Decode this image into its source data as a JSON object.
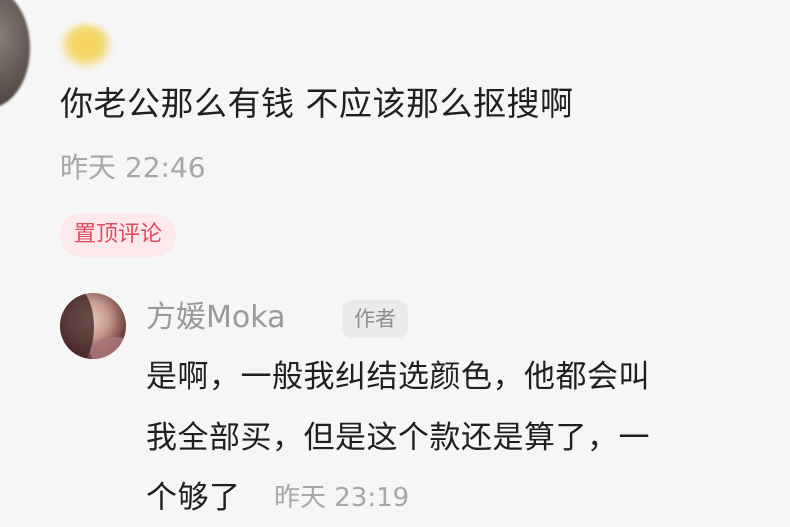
{
  "comment": {
    "text": "你老公那么有钱 不应该那么抠搜啊",
    "time": "昨天 22:46",
    "pinned_badge": "置顶评论"
  },
  "reply": {
    "author_name": "方媛Moka",
    "author_badge": "作者",
    "text_lines": [
      "是啊，一般我纠结选颜色，他都会叫",
      "我全部买，但是这个款还是算了，一",
      "个够了"
    ],
    "time": "昨天 23:19"
  }
}
